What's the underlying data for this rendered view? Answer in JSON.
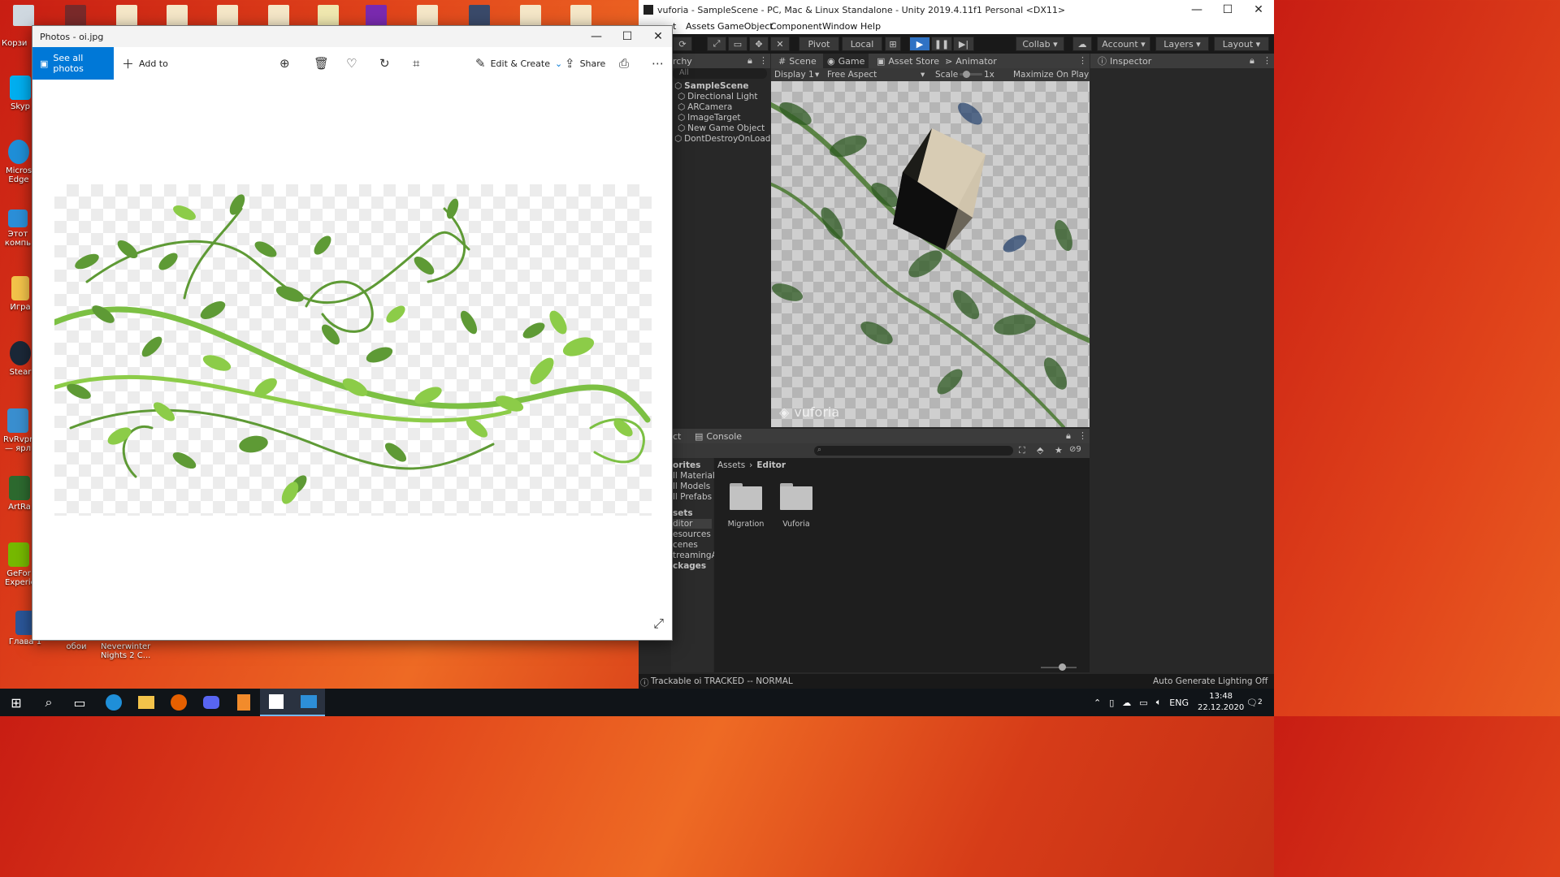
{
  "desktop": {
    "icons": [
      {
        "label": "Корзи",
        "color": "#9ab8d8"
      },
      {
        "label": "Skyp",
        "color": "#00aff0"
      },
      {
        "label": "Micros Edge",
        "color": "#1f8fd8"
      },
      {
        "label": "Этот компь",
        "color": "#2c8fd8"
      },
      {
        "label": "Игра",
        "color": "#f3c34a"
      },
      {
        "label": "Stear",
        "color": "#1b2838"
      },
      {
        "label": "RvRvpr — ярл",
        "color": "#3a8fd0"
      },
      {
        "label": "ArtRa",
        "color": "#2d6a2f"
      },
      {
        "label": "GeFor Experie",
        "color": "#76b900"
      },
      {
        "label": "Глава 1",
        "color": "#2b579a"
      }
    ],
    "bottom_labels": [
      "обои",
      "Neverwinter Nights 2 C..."
    ]
  },
  "photos": {
    "title": "Photos - oi.jpg",
    "see_all": "See all photos",
    "add_to": "Add to",
    "edit_create": "Edit & Create",
    "share": "Share",
    "minimize": "—",
    "maximize": "☐",
    "close": "✕",
    "more": "⋯",
    "accent_color": "#0078d7"
  },
  "unity": {
    "title": "vuforia - SampleScene - PC, Mac & Linux Standalone - Unity 2019.4.11f1 Personal <DX11>",
    "menu": [
      "Assets",
      "GameObject",
      "Component",
      "Window",
      "Help"
    ],
    "menu_partial": "t",
    "toolbar": {
      "pivot": "Pivot",
      "local": "Local",
      "collab": "Collab",
      "account": "Account",
      "layers": "Layers",
      "layout": "Layout"
    },
    "hierarchy": {
      "tab_partial": "rchy",
      "search_placeholder": "All",
      "scene": "SampleScene",
      "items": [
        "Directional Light",
        "ARCamera",
        "ImageTarget",
        "New Game Object",
        "DontDestroyOnLoad"
      ]
    },
    "game": {
      "tabs": [
        "Scene",
        "Game",
        "Asset Store",
        "Animator"
      ],
      "display": "Display 1",
      "aspect": "Free Aspect",
      "scale_label": "Scale",
      "scale_value": "1x",
      "maximize": "Maximize On Play",
      "watermark": "vuforia"
    },
    "inspector": {
      "tab": "Inspector"
    },
    "project": {
      "tab_partial": "ct",
      "console": "Console",
      "hidden_count": "9",
      "breadcrumb": [
        "Assets",
        "Editor"
      ],
      "favorites": [
        "orites",
        "ll Materials",
        "ll Models",
        "ll Prefabs"
      ],
      "assets_tree": [
        "sets",
        "ditor",
        "esources",
        "cenes",
        "treamingA",
        "ckages"
      ],
      "folders": [
        "Migration",
        "Vuforia"
      ]
    },
    "status": {
      "message": "Trackable oi TRACKED -- NORMAL",
      "lighting": "Auto Generate Lighting Off"
    }
  },
  "taskbar": {
    "language": "ENG",
    "time": "13:48",
    "date": "22.12.2020",
    "notifications": "2"
  }
}
